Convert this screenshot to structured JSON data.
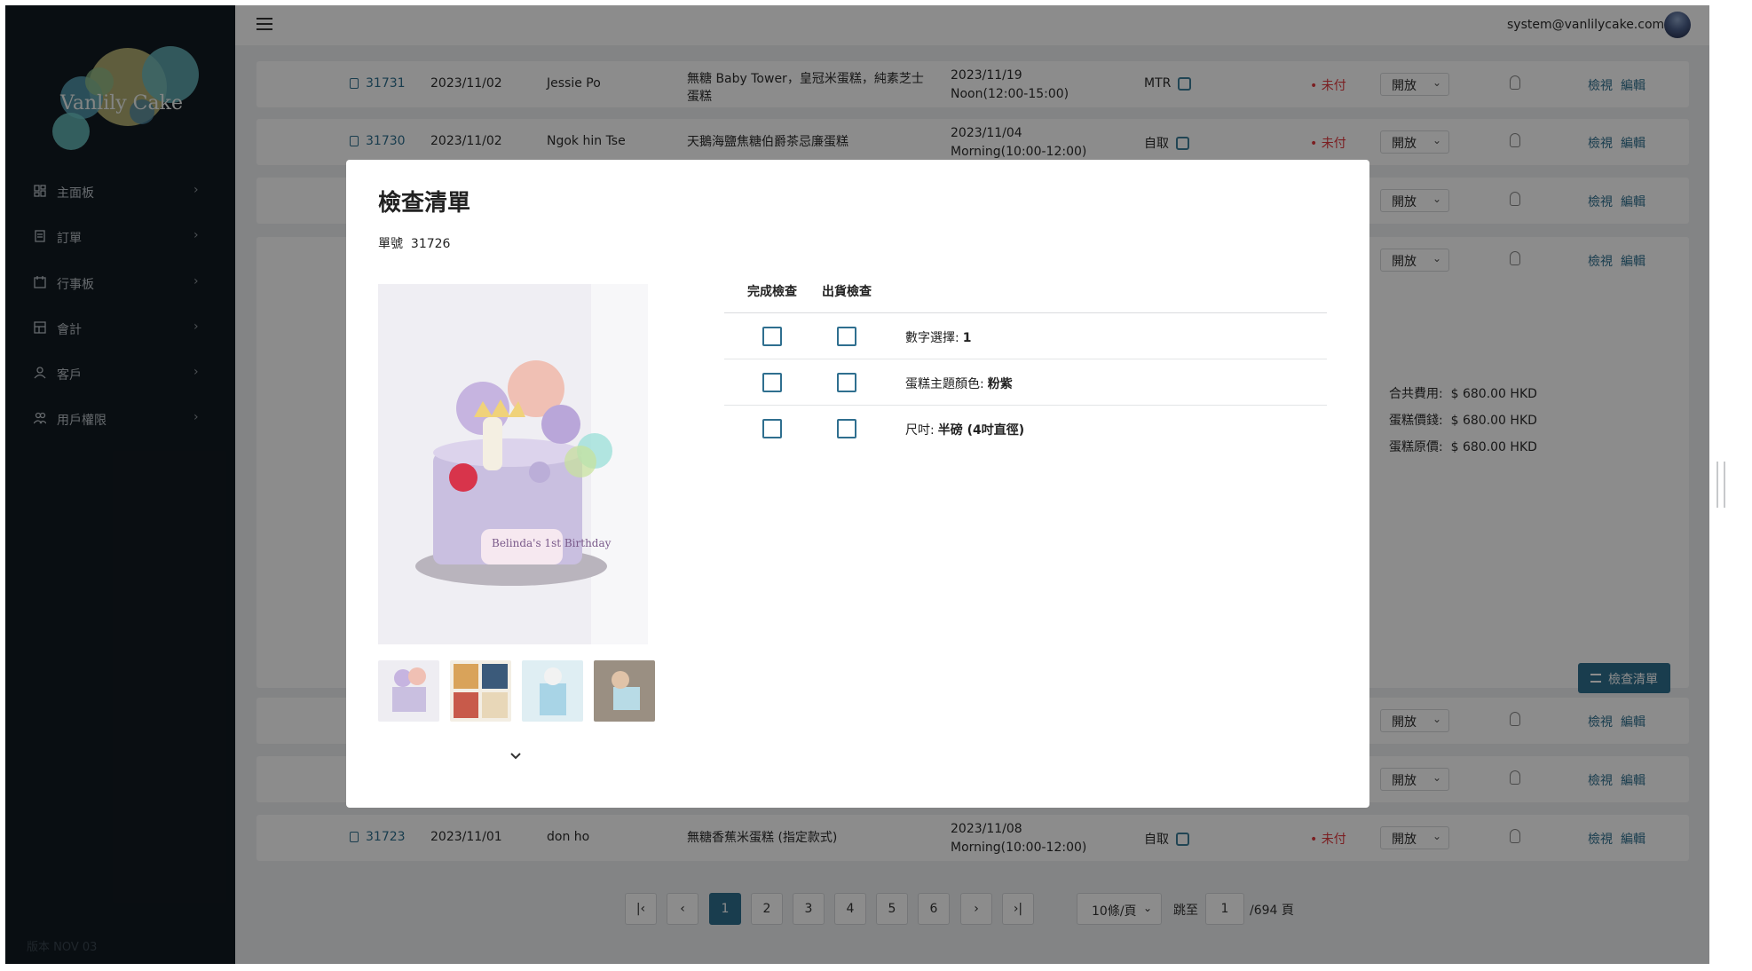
{
  "app": {
    "brand": "Vanlily Cake",
    "version": "版本 NOV 03",
    "user_email": "system@vanlilycake.com"
  },
  "sidebar": {
    "items": [
      {
        "label": "主面板",
        "icon": "dashboard-icon"
      },
      {
        "label": "訂單",
        "icon": "order-icon"
      },
      {
        "label": "行事板",
        "icon": "calendar-icon"
      },
      {
        "label": "會計",
        "icon": "accounting-icon"
      },
      {
        "label": "客戶",
        "icon": "customer-icon"
      },
      {
        "label": "用戶權限",
        "icon": "user-permission-icon"
      }
    ]
  },
  "orders": {
    "rows": [
      {
        "no": "31731",
        "date": "2023/11/02",
        "customer": "Jessie Po",
        "product": "無糖 Baby Tower，皇冠米蛋糕，純素芝士蛋糕",
        "delivery_date": "2023/11/19",
        "delivery_time": "Noon(12:00-15:00)",
        "method": "MTR",
        "payment": "• 未付",
        "status": "開放",
        "view": "檢視",
        "edit": "編輯"
      },
      {
        "no": "31730",
        "date": "2023/11/02",
        "customer": "Ngok hin Tse",
        "product": "天鵝海鹽焦糖伯爵茶忌廉蛋糕",
        "delivery_date": "2023/11/04",
        "delivery_time": "Morning(10:00-12:00)",
        "method": "自取",
        "payment": "• 未付",
        "status": "開放",
        "view": "檢視",
        "edit": "編輯"
      },
      {
        "status": "開放",
        "view": "檢視",
        "edit": "編輯"
      },
      {
        "status": "開放",
        "view": "檢視",
        "edit": "編輯"
      },
      {
        "status": "開放",
        "view": "檢視",
        "edit": "編輯"
      },
      {
        "status": "開放",
        "view": "檢視",
        "edit": "編輯"
      },
      {
        "no": "31723",
        "date": "2023/11/01",
        "customer": "don ho",
        "product": "無糖香蕉米蛋糕 (指定款式)",
        "delivery_date": "2023/11/08",
        "delivery_time": "Morning(10:00-12:00)",
        "method": "自取",
        "payment": "• 未付",
        "status": "開放",
        "view": "檢視",
        "edit": "編輯"
      }
    ]
  },
  "expanded": {
    "total_label": "合共費用:",
    "total_value": "$ 680.00 HKD",
    "cake_price_label": "蛋糕價錢:",
    "cake_price_value": "$ 680.00 HKD",
    "cake_orig_label": "蛋糕原價:",
    "cake_orig_value": "$ 680.00 HKD",
    "checklist_button": "檢查清單"
  },
  "pagination": {
    "pages": [
      "1",
      "2",
      "3",
      "4",
      "5",
      "6"
    ],
    "current": "1",
    "page_size": "10條/頁",
    "jump_label": "跳至",
    "jump_value": "1",
    "total_pages": "/694 頁"
  },
  "modal": {
    "title": "檢查清單",
    "order_label": "單號",
    "order_no": "31726",
    "col_complete": "完成檢查",
    "col_ship": "出貨檢查",
    "items": [
      {
        "label": "數字選擇:",
        "value": "1"
      },
      {
        "label": "蛋糕主題顏色:",
        "value": "粉紫"
      },
      {
        "label": "尺吋:",
        "value": "半磅 (4吋直徑)"
      }
    ],
    "image_plaque_text": "Belinda's 1st Birthday"
  },
  "colors": {
    "accent": "#2f6f8f",
    "sidebar_bg": "#121a21",
    "unpaid": "#e0393e"
  }
}
